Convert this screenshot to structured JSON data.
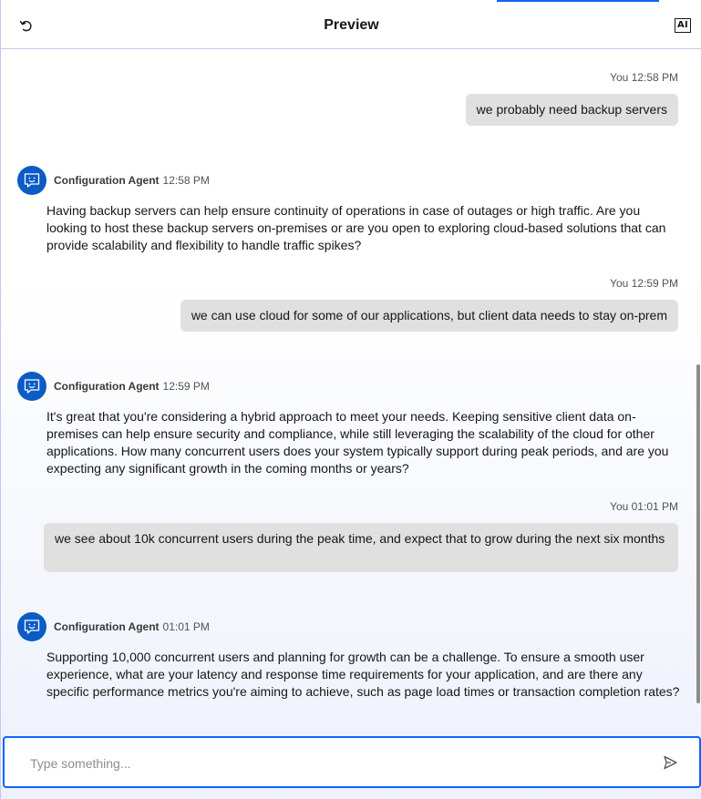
{
  "header": {
    "title": "Preview",
    "ai_badge": "AI",
    "reset_icon": "reset-icon"
  },
  "messages": [
    {
      "role": "user",
      "meta": "You 12:58 PM",
      "text": "we probably need backup servers"
    },
    {
      "role": "agent",
      "name": "Configuration Agent",
      "time": "12:58 PM",
      "text": "Having backup servers can help ensure continuity of operations in case of outages or high traffic. Are you looking to host these backup servers on-premises or are you open to exploring cloud-based solutions that can provide scalability and flexibility to handle traffic spikes?"
    },
    {
      "role": "user",
      "meta": "You 12:59 PM",
      "text": "we can use cloud for some of our applications, but client data needs to stay on-prem"
    },
    {
      "role": "agent",
      "name": "Configuration Agent",
      "time": "12:59 PM",
      "text": "It's great that you're considering a hybrid approach to meet your needs. Keeping sensitive client data on-premises can help ensure security and compliance, while still leveraging the scalability of the cloud for other applications. How many concurrent users does your system typically support during peak periods, and are you expecting any significant growth in the coming months or years?"
    },
    {
      "role": "user",
      "meta": "You 01:01 PM",
      "text": "we see about 10k concurrent users during the peak time, and expect that to grow during the next six months"
    },
    {
      "role": "agent",
      "name": "Configuration Agent",
      "time": "01:01 PM",
      "text": "Supporting 10,000 concurrent users and planning for growth can be a challenge. To ensure a smooth user experience, what are your latency and response time requirements for your application, and are there any specific performance metrics you're aiming to achieve, such as page load times or transaction completion rates?"
    }
  ],
  "composer": {
    "placeholder": "Type something...",
    "value": "",
    "send_icon": "send-icon"
  },
  "colors": {
    "accent": "#0f62fe",
    "avatar": "#0b5cc5",
    "user_bubble": "#e0e0e0"
  }
}
